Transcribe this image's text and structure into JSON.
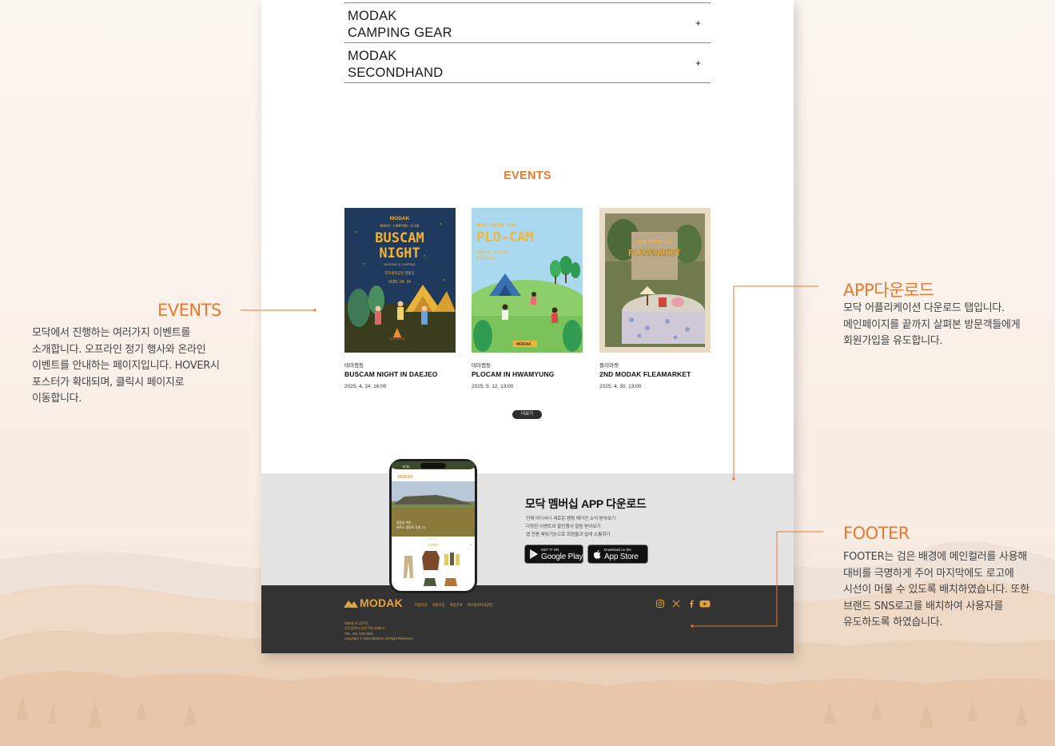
{
  "accordion": [
    {
      "label": "MODAK\nCAMPING GEAR",
      "toggle": "+"
    },
    {
      "label": "MODAK\nSECONDHAND",
      "toggle": "+"
    }
  ],
  "events": {
    "heading": "EVENTS",
    "items": [
      {
        "category": "테마캠핑",
        "title": "BUSCAM NIGHT IN DAEJEO",
        "date": "2025. 4. 24. 16:00",
        "poster": {
          "brand": "MODAK",
          "club": "MODAC CAMPING CLUB",
          "line1": "BUSCAM",
          "line2": "NIGHT",
          "sub": "BUSKING & CAMPING",
          "kr": "대저생태공원 캠핑장",
          "date": "2025. 04. 24"
        }
      },
      {
        "category": "테마캠핑",
        "title": "PLOCAM IN HWAMYUNG",
        "date": "2025. 5. 12. 13:00",
        "poster": {
          "club": "MODAK CAMPING CLUB",
          "line1": "PLO-CAM",
          "date": "2025. 05. 12. 13:00",
          "place": "화명생태공원",
          "brand": "MODAK"
        }
      },
      {
        "category": "플리마켓",
        "title": "2ND MODAK FLEAMARKET",
        "date": "2025. 4. 30. 13:00",
        "poster": {
          "club": "MODAK CAMPING CLUB",
          "line1": "FLEAMARKET"
        }
      }
    ],
    "more_label": "더보기"
  },
  "app_download": {
    "title": "모닥 멤버십 APP 다운로드",
    "description": "언제 어디서나 새로운 캠핑 매거진 소식 받아보기\n다양한 이벤트와 할인행사 알림 받아보기\n앱 전용 채팅기능으로 회원들과 쉽게 소통하기",
    "google": {
      "small": "GET IT ON",
      "big": "Google Play"
    },
    "apple": {
      "small": "Download on the",
      "big": "App Store"
    },
    "phone": {
      "time": "9:41",
      "brand": "MODAK",
      "hero_text": "캠핑의 여운,\n제주도 캠핑지 추천 10",
      "shop_label": "SHOP",
      "shop_plus": "+"
    }
  },
  "footer": {
    "logo": "MODAK",
    "links": [
      "이용약관",
      "회원가입",
      "매장안내",
      "개인정보처리방침"
    ],
    "info": "대표자:모 김모닥\n부산광역시 대부구동 2456-3\nTEL. 051 334-2834\nCopyright © 2023 MODAK All Right Reserved."
  },
  "notes": {
    "events": {
      "title": "EVENTS",
      "body": "모닥에서 진행하는 여러가지 이벤트를 소개합니다. 오프라인 정기 행사와 온라인 이벤트를 안내하는 페이지입니다. HOVER시 포스터가 확대되며, 클릭시 페이지로 이동합니다."
    },
    "app": {
      "title": "APP다운로드",
      "body": "모닥 어플리케이션 다운로드 탭입니다. 메인페이지를 끝까지 살펴본 방문객들에게 회원가입을 유도합니다."
    },
    "footer": {
      "title": "FOOTER",
      "body": "FOOTER는 검은 배경에 메인컬러를 사용해 대비를 극명하게 주어 마지막에도 로고에 시선이 머물 수 있도록 배치하였습니다. 또한 브랜드 SNS로고를 배치하여 사용자를 유도하도록 하였습니다."
    }
  },
  "colors": {
    "accent": "#e67a2e",
    "footer_bg": "#333333",
    "footer_text": "#e4a23a",
    "app_band": "#e3e3e3"
  }
}
